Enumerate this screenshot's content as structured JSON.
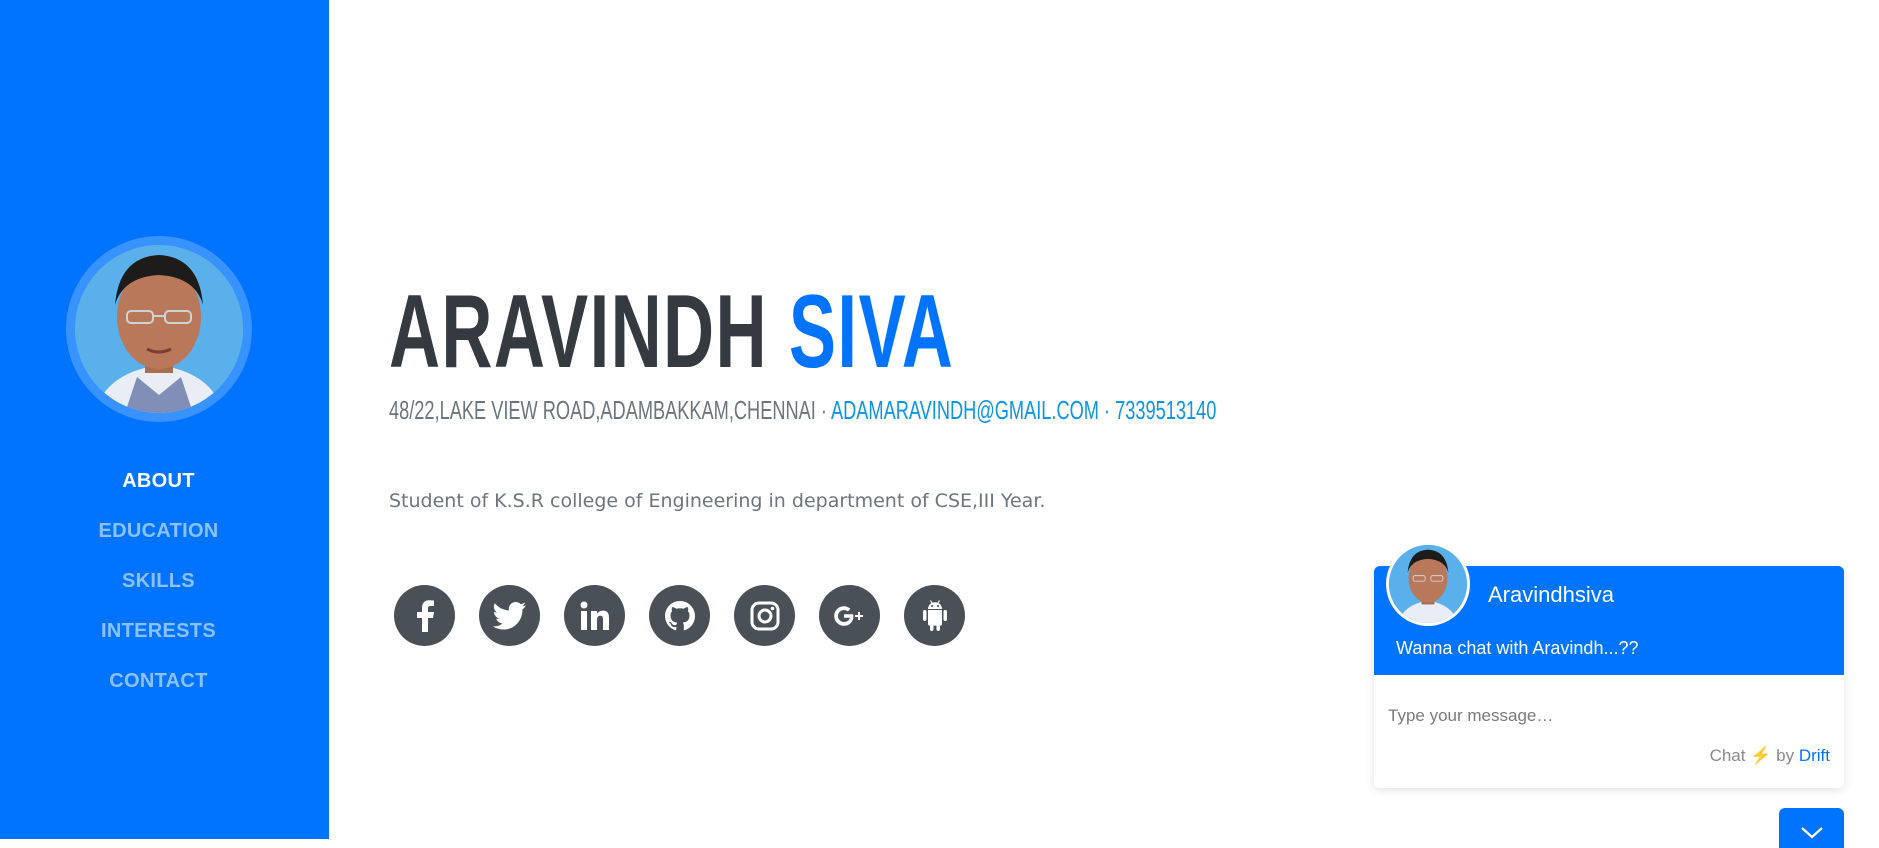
{
  "sidebar": {
    "nav": [
      {
        "label": "ABOUT",
        "active": true
      },
      {
        "label": "EDUCATION",
        "active": false
      },
      {
        "label": "SKILLS",
        "active": false
      },
      {
        "label": "INTERESTS",
        "active": false
      },
      {
        "label": "CONTACT",
        "active": false
      }
    ]
  },
  "profile": {
    "first_name": "ARAVINDH",
    "last_name": "SIVA",
    "address": "48/22,LAKE VIEW ROAD,ADAMBAKKAM,CHENNAI ·",
    "email": "ADAMARAVINDH@GMAIL.COM",
    "separator": "·",
    "phone": "7339513140",
    "bio": "Student of K.S.R college of Engineering in department of CSE,III Year."
  },
  "social": [
    {
      "name": "facebook-icon"
    },
    {
      "name": "twitter-icon"
    },
    {
      "name": "linkedin-icon"
    },
    {
      "name": "github-icon"
    },
    {
      "name": "instagram-icon"
    },
    {
      "name": "google-plus-icon"
    },
    {
      "name": "android-icon"
    }
  ],
  "chat": {
    "title": "Aravindhsiva",
    "subtitle": "Wanna chat with Aravindh...??",
    "placeholder": "Type your message…",
    "footer_prefix": "Chat",
    "footer_bolt": "⚡",
    "footer_by": "by",
    "footer_brand": "Drift"
  },
  "colors": {
    "primary": "#0074ff",
    "dark": "#343a40",
    "muted": "#6c757d",
    "link": "#0a95e8",
    "icon_bg": "#495057"
  }
}
